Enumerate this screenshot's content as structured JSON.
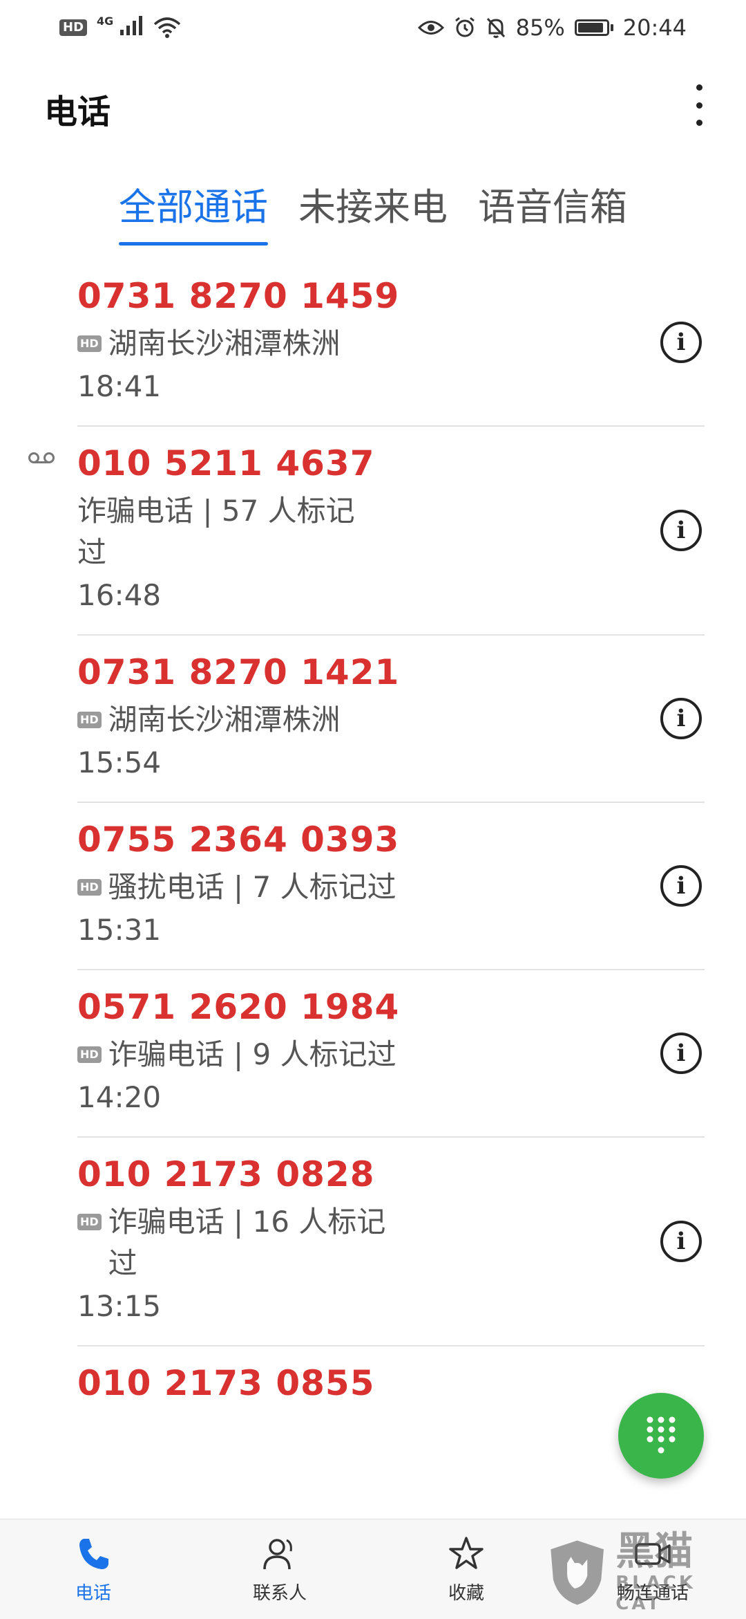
{
  "status_bar": {
    "hd": "HD",
    "network": "4G",
    "battery": "85%",
    "time": "20:44"
  },
  "header": {
    "title": "电话"
  },
  "tabs": [
    {
      "label": "全部通话",
      "active": true
    },
    {
      "label": "未接来电",
      "active": false
    },
    {
      "label": "语音信箱",
      "active": false
    }
  ],
  "calls": [
    {
      "number": "0731 8270 1459",
      "hd": true,
      "desc": "湖南长沙湘潭株洲",
      "time": "18:41",
      "voicemail": false
    },
    {
      "number": "010 5211 4637",
      "hd": false,
      "desc": "诈骗电话 | 57 人标记过",
      "time": "16:48",
      "voicemail": true
    },
    {
      "number": "0731 8270 1421",
      "hd": true,
      "desc": "湖南长沙湘潭株洲",
      "time": "15:54",
      "voicemail": false
    },
    {
      "number": "0755 2364 0393",
      "hd": true,
      "desc": "骚扰电话 | 7 人标记过",
      "time": "15:31",
      "voicemail": false
    },
    {
      "number": "0571 2620 1984",
      "hd": true,
      "desc": "诈骗电话 | 9 人标记过",
      "time": "14:20",
      "voicemail": false
    },
    {
      "number": "010 2173 0828",
      "hd": true,
      "desc": "诈骗电话 | 16 人标记过",
      "time": "13:15",
      "voicemail": false
    },
    {
      "number": "010 2173 0855",
      "hd": false,
      "desc": "",
      "time": "",
      "voicemail": false
    }
  ],
  "hd_label": "HD",
  "info_glyph": "i",
  "bottom_nav": [
    {
      "label": "电话",
      "icon": "phone-icon",
      "active": true
    },
    {
      "label": "联系人",
      "icon": "contacts-icon",
      "active": false
    },
    {
      "label": "收藏",
      "icon": "star-icon",
      "active": false
    },
    {
      "label": "畅连通话",
      "icon": "video-call-icon",
      "active": false
    }
  ],
  "watermark": {
    "cn": "黑猫",
    "en": "BLACK CAT"
  },
  "colors": {
    "accent": "#1a73e8",
    "missed": "#d9312f",
    "fab": "#3ab54a"
  }
}
